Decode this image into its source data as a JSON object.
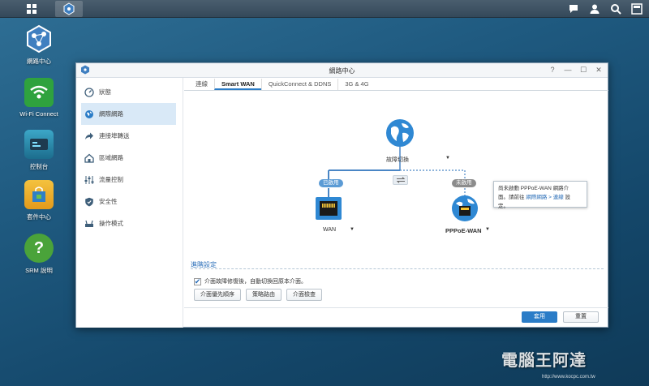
{
  "desktop": {
    "icons": [
      {
        "label": "網路中心"
      },
      {
        "label": "Wi-Fi Connect"
      },
      {
        "label": "控制台"
      },
      {
        "label": "套件中心"
      },
      {
        "label": "SRM 說明"
      }
    ]
  },
  "window": {
    "title": "網路中心",
    "controls": {
      "help": "?",
      "minimize": "—",
      "maximize": "☐",
      "close": "✕"
    }
  },
  "sidebar": {
    "items": [
      {
        "label": "狀態",
        "icon": "gauge-icon"
      },
      {
        "label": "網際網路",
        "icon": "globe-icon"
      },
      {
        "label": "連接埠轉送",
        "icon": "forward-arrow-icon"
      },
      {
        "label": "區域網路",
        "icon": "home-network-icon"
      },
      {
        "label": "流量控制",
        "icon": "sliders-icon"
      },
      {
        "label": "安全性",
        "icon": "shield-icon"
      },
      {
        "label": "操作模式",
        "icon": "router-icon"
      }
    ]
  },
  "tabs": [
    {
      "label": "連線"
    },
    {
      "label": "Smart WAN"
    },
    {
      "label": "QuickConnect & DDNS"
    },
    {
      "label": "3G & 4G"
    }
  ],
  "diagram": {
    "top_label": "故障切換",
    "left_badge": "已啟用",
    "right_badge": "未啟用",
    "left_label": "WAN",
    "right_label": "PPPoE-WAN",
    "colors": {
      "enabled": "#5b9bd5",
      "disabled": "#8c8c8c",
      "line": "#4a86c5"
    }
  },
  "tooltip": {
    "line1": "尚未啟動 PPPoE-WAN 網路介",
    "line2_prefix": "面。請前往 ",
    "link": "網際網路 > 連線",
    "line2_suffix": " 設",
    "line3": "定。"
  },
  "advanced": {
    "title": "進階設定",
    "checkbox_label": "介面故障修復後，自動切換回原本介面。",
    "buttons": [
      "介面優先順序",
      "策略路由",
      "介面檢查"
    ]
  },
  "footer": {
    "apply": "套用",
    "reset": "重置"
  },
  "watermark": {
    "text": "電腦王阿達",
    "url": "http://www.kocpc.com.tw"
  }
}
